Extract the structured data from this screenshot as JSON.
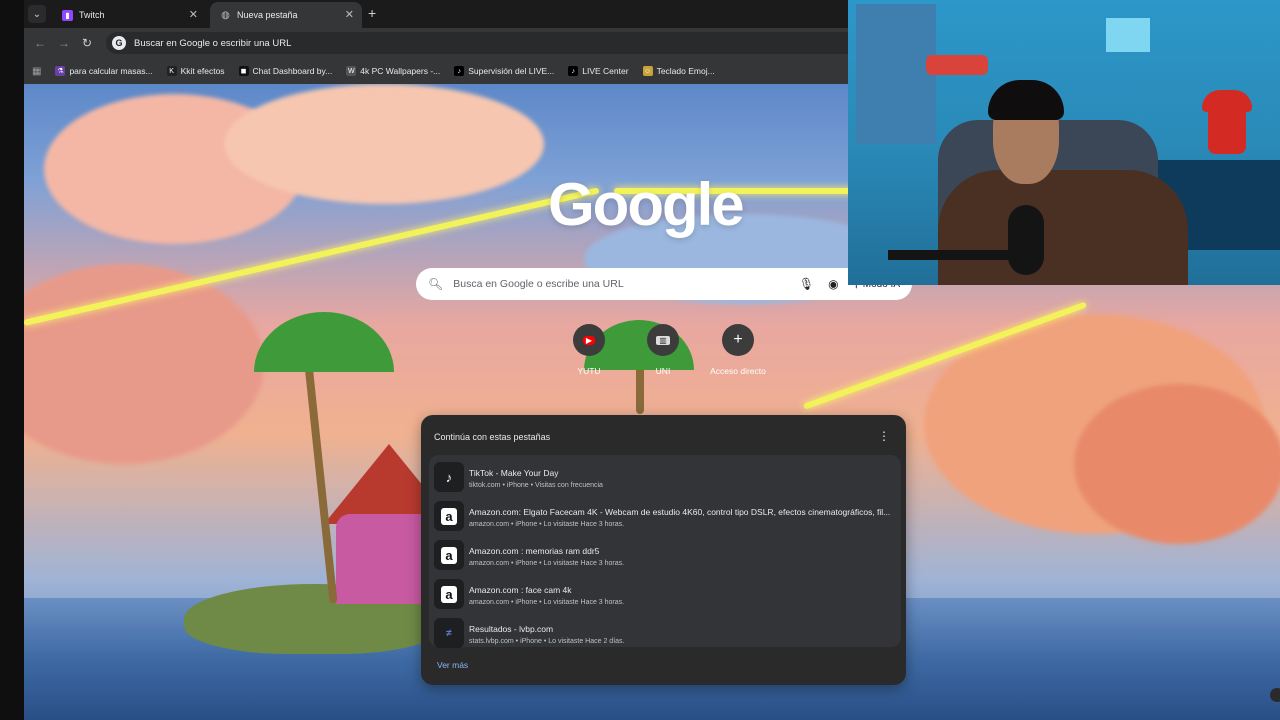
{
  "browser": {
    "tabs": [
      {
        "label": "Twitch",
        "icon": "twitch-icon"
      },
      {
        "label": "Nueva pestaña",
        "icon": "globe-icon"
      }
    ],
    "omnibox_text": "Buscar en Google o escribir una URL",
    "bookmarks": [
      {
        "label": "para calcular masas...",
        "icon": "flask-icon"
      },
      {
        "label": "Kkit efectos",
        "icon": "kkit-icon"
      },
      {
        "label": "Chat Dashboard by...",
        "icon": "chat-icon"
      },
      {
        "label": "4k PC Wallpapers -...",
        "icon": "wallpaper-icon"
      },
      {
        "label": "Supervisión del LIVE...",
        "icon": "tiktok-icon"
      },
      {
        "label": "LIVE Center",
        "icon": "tiktok-icon"
      },
      {
        "label": "Teclado Emoj...",
        "icon": "emoji-icon"
      }
    ]
  },
  "newtab": {
    "logo": "Google",
    "search_placeholder": "Busca en Google o escribe una URL",
    "ai_mode_label": "Modo IA",
    "shortcuts": [
      {
        "label": "YUTU",
        "icon": "youtube-icon"
      },
      {
        "label": "UNI",
        "icon": "uni-icon"
      },
      {
        "label": "Acceso directo",
        "icon": "plus-icon"
      }
    ]
  },
  "continue_panel": {
    "title": "Continúa con estas pestañas",
    "items": [
      {
        "title": "TikTok - Make Your Day",
        "meta": "tiktok.com • iPhone • Visitas con frecuencia",
        "icon": "tiktok-icon"
      },
      {
        "title": "Amazon.com: Elgato Facecam 4K - Webcam de estudio 4K60, control tipo DSLR, efectos cinematográficos, fil...",
        "meta": "amazon.com • iPhone • Lo visitaste Hace 3 horas.",
        "icon": "amazon-icon"
      },
      {
        "title": "Amazon.com : memorias ram ddr5",
        "meta": "amazon.com • iPhone • Lo visitaste Hace 3 horas.",
        "icon": "amazon-icon"
      },
      {
        "title": "Amazon.com : face cam 4k",
        "meta": "amazon.com • iPhone • Lo visitaste Hace 3 horas.",
        "icon": "amazon-icon"
      },
      {
        "title": "Resultados - lvbp.com",
        "meta": "stats.lvbp.com • iPhone • Lo visitaste Hace 2 días.",
        "icon": "lvbp-icon"
      }
    ],
    "more_label": "Ver más"
  }
}
